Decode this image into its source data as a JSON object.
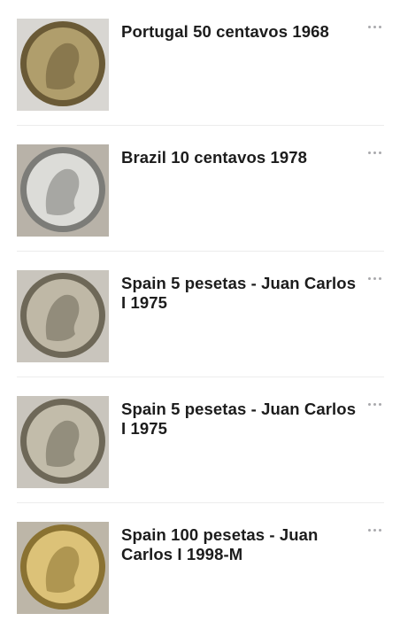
{
  "items": [
    {
      "title": "Portugal 50 centavos 1968",
      "icon": "more-horizontal-icon",
      "colors": {
        "background": "#d8d6d2",
        "coin_light": "#b09e6c",
        "coin_dark": "#6a5a36"
      }
    },
    {
      "title": "Brazil 10 centavos 1978",
      "icon": "more-horizontal-icon",
      "colors": {
        "background": "#b8b2a8",
        "coin_light": "#dcdcd8",
        "coin_dark": "#7c7c78"
      }
    },
    {
      "title": "Spain 5 pesetas - Juan Carlos I 1975",
      "icon": "more-horizontal-icon",
      "colors": {
        "background": "#c9c5bd",
        "coin_light": "#bfb8a6",
        "coin_dark": "#6e6858"
      }
    },
    {
      "title": "Spain 5 pesetas - Juan Carlos I 1975",
      "icon": "more-horizontal-icon",
      "colors": {
        "background": "#c9c5bd",
        "coin_light": "#c2bcaa",
        "coin_dark": "#6e6858"
      }
    },
    {
      "title": "Spain 100 pesetas - Juan Carlos I 1998-M",
      "icon": "more-horizontal-icon",
      "colors": {
        "background": "#bdb6a8",
        "coin_light": "#dcc278",
        "coin_dark": "#8a7232"
      }
    }
  ]
}
